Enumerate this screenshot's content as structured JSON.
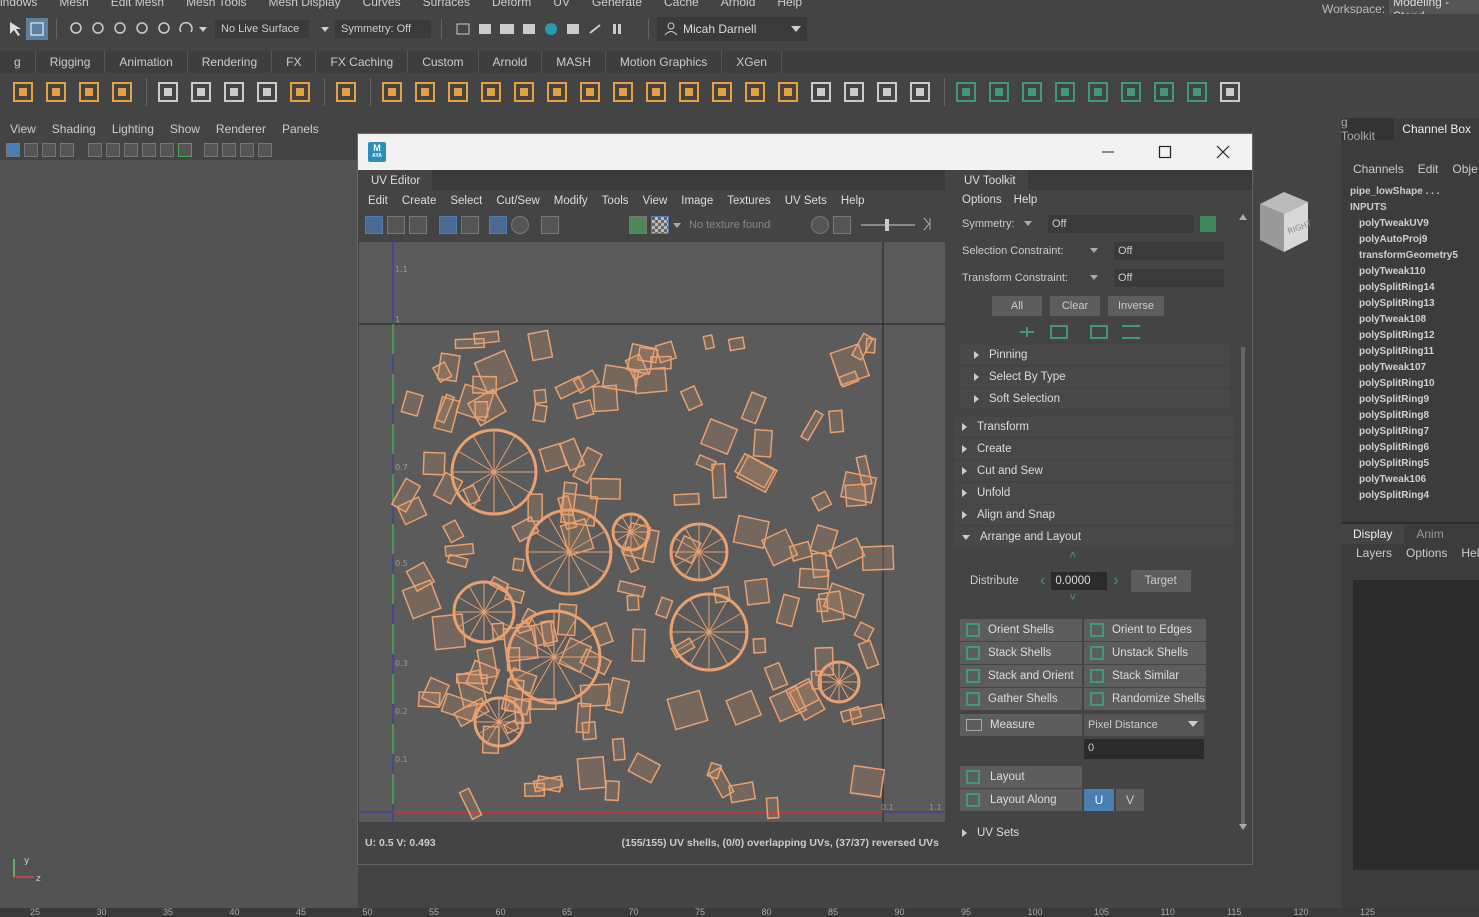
{
  "main_menu": [
    "indows",
    "Mesh",
    "Edit Mesh",
    "Mesh Tools",
    "Mesh Display",
    "Curves",
    "Surfaces",
    "Deform",
    "UV",
    "Generate",
    "Cache",
    "Arnold",
    "Help"
  ],
  "workspace": {
    "label": "Workspace:",
    "value": "Modeling - Stand"
  },
  "status_line": {
    "live_surface": "No Live Surface",
    "symmetry": "Symmetry: Off",
    "user": "Micah Darnell"
  },
  "shelf_tabs": [
    "g",
    "Rigging",
    "Animation",
    "Rendering",
    "FX",
    "FX Caching",
    "Custom",
    "Arnold",
    "MASH",
    "Motion Graphics",
    "XGen"
  ],
  "panel_menu": [
    "View",
    "Shading",
    "Lighting",
    "Show",
    "Renderer",
    "Panels"
  ],
  "viewcube_label": "RIGHT",
  "window": {
    "app_badge": "M",
    "app_badge_sub": "AYA"
  },
  "uv_editor": {
    "tab": "UV Editor",
    "menu": [
      "Edit",
      "Create",
      "Select",
      "Cut/Sew",
      "Modify",
      "Tools",
      "View",
      "Image",
      "Textures",
      "UV Sets",
      "Help"
    ],
    "texture_status": "No texture found",
    "grid_labels": [
      "1.1",
      "1",
      "0.7",
      "0.5",
      "0.3",
      "0.2",
      "0.1",
      "0.1",
      "1.1"
    ],
    "status_left": "U:  0.5 V:  0.493",
    "status_right": "(155/155) UV shells, (0/0) overlapping UVs, (37/37) reversed UVs"
  },
  "uv_toolkit": {
    "tab": "UV Toolkit",
    "menu": [
      "Options",
      "Help"
    ],
    "symmetry": {
      "label": "Symmetry:",
      "value": "Off"
    },
    "selection_constraint": {
      "label": "Selection Constraint:",
      "value": "Off"
    },
    "transform_constraint": {
      "label": "Transform Constraint:",
      "value": "Off"
    },
    "buttons": {
      "all": "All",
      "clear": "Clear",
      "inverse": "Inverse"
    },
    "sub_sections": [
      "Pinning",
      "Select By Type",
      "Soft Selection"
    ],
    "sections": [
      "Transform",
      "Create",
      "Cut and Sew",
      "Unfold",
      "Align and Snap"
    ],
    "open_section": "Arrange and Layout",
    "distribute": {
      "label": "Distribute",
      "value": "0.0000",
      "target": "Target"
    },
    "actions": [
      [
        "Orient Shells",
        "Orient to Edges"
      ],
      [
        "Stack Shells",
        "Unstack Shells"
      ],
      [
        "Stack and Orient",
        "Stack Similar"
      ],
      [
        "Gather Shells",
        "Randomize Shells"
      ]
    ],
    "measure": {
      "label": "Measure",
      "mode": "Pixel Distance",
      "value": "0"
    },
    "layout": "Layout",
    "layout_along": {
      "label": "Layout Along",
      "u": "U",
      "v": "V"
    },
    "uv_sets_section": "UV Sets"
  },
  "channel_box": {
    "tabs": [
      "g Toolkit",
      "Channel Box"
    ],
    "menu": [
      "Channels",
      "Edit",
      "Obje"
    ],
    "object": "pipe_lowShape . . .",
    "inputs_label": "INPUTS",
    "inputs": [
      "polyTweakUV9",
      "polyAutoProj9",
      "transformGeometry5",
      "polyTweak110",
      "polySplitRing14",
      "polySplitRing13",
      "polyTweak108",
      "polySplitRing12",
      "polySplitRing11",
      "polyTweak107",
      "polySplitRing10",
      "polySplitRing9",
      "polySplitRing8",
      "polySplitRing7",
      "polySplitRing6",
      "polySplitRing5",
      "polyTweak106",
      "polySplitRing4"
    ],
    "layer_tabs": [
      "Display",
      "Anim"
    ],
    "layer_menu": [
      "Layers",
      "Options",
      "Help"
    ]
  },
  "timeline_ticks": [
    "25",
    "30",
    "35",
    "40",
    "45",
    "50",
    "55",
    "60",
    "65",
    "70",
    "75",
    "80",
    "85",
    "90",
    "95",
    "100",
    "105",
    "110",
    "115",
    "120",
    "125"
  ],
  "colors": {
    "uv_shell": "#e8a070",
    "accent_blue": "#4a7fb5",
    "bg": "#444444",
    "panel": "#3c3c3c"
  }
}
